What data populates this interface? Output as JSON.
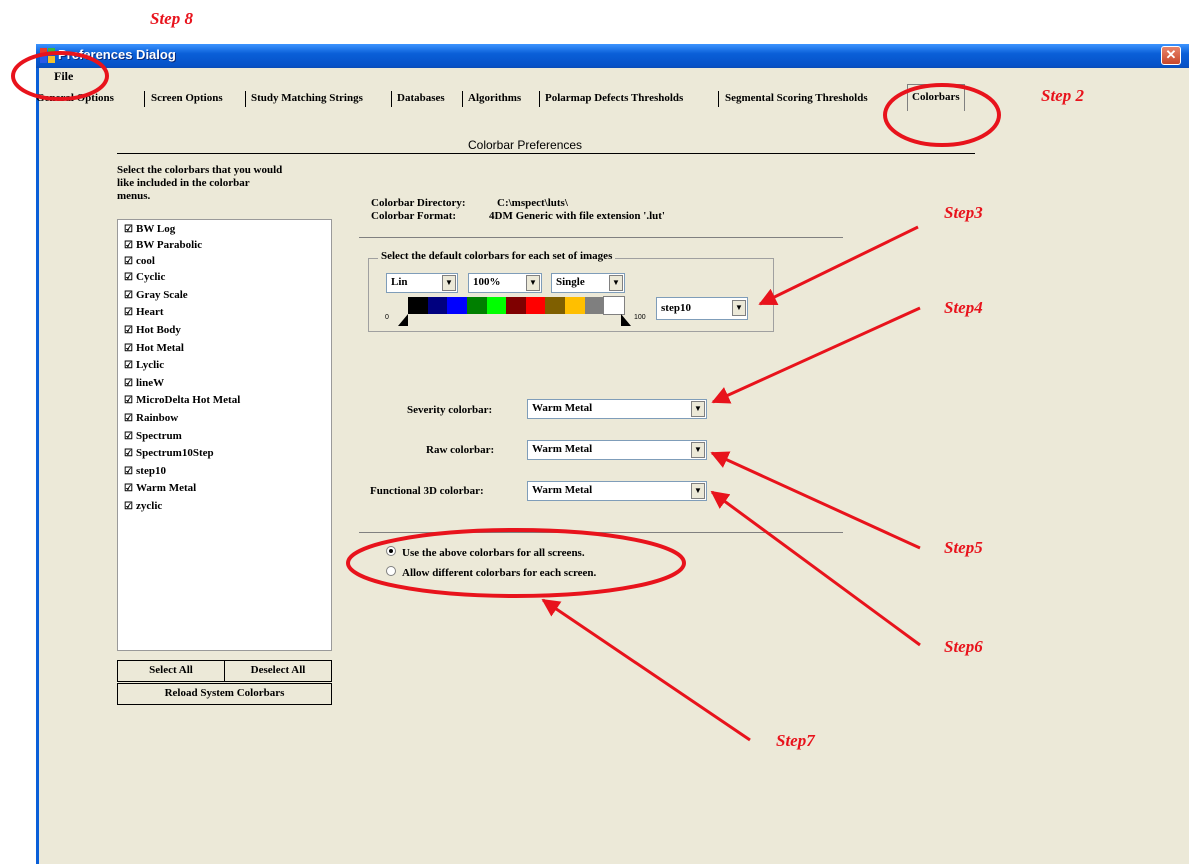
{
  "window": {
    "title": "Preferences Dialog",
    "close_glyph": "✕"
  },
  "menu": {
    "file": "File"
  },
  "tabs": [
    "General Options",
    "Screen Options",
    "Study Matching Strings",
    "Databases",
    "Algorithms",
    "Polarmap Defects Thresholds",
    "Segmental Scoring Thresholds",
    "Colorbars"
  ],
  "active_tab": "Colorbars",
  "section": {
    "heading": "Colorbar Preferences"
  },
  "left_panel": {
    "instructions": [
      "Select the colorbars that you would",
      "like included in the colorbar",
      "menus."
    ],
    "colorbars": [
      "BW Log",
      "BW Parabolic",
      "cool",
      "Cyclic",
      "Gray Scale",
      "Heart",
      "Hot Body",
      "Hot Metal",
      "Lyclic",
      "lineW",
      "MicroDelta Hot Metal",
      "Rainbow",
      "Spectrum",
      "Spectrum10Step",
      "step10",
      "Warm Metal",
      "zyclic"
    ],
    "select_all": "Select All",
    "deselect_all": "Deselect All",
    "reload": "Reload System Colorbars"
  },
  "info": {
    "dir_label": "Colorbar Directory:",
    "dir_value": "C:\\mspect\\luts\\",
    "format_label": "Colorbar Format:",
    "format_value": "4DM Generic with file extension '.lut'"
  },
  "default_group": {
    "legend": "Select the default colorbars for each set of images",
    "scale": "Lin",
    "percent": "100%",
    "mode": "Single",
    "min_label": "0",
    "max_label": "100",
    "colorbar": "step10",
    "swatch_colors": [
      "#000000",
      "#00007F",
      "#0000FF",
      "#007F00",
      "#00FF00",
      "#7F0000",
      "#FF0000",
      "#7F5F00",
      "#FFBF00",
      "#7F7F7F",
      "#FFFFFF"
    ]
  },
  "selectors": {
    "severity_label": "Severity colorbar:",
    "severity_value": "Warm Metal",
    "raw_label": "Raw colorbar:",
    "raw_value": "Warm Metal",
    "functional_label": "Functional 3D colorbar:",
    "functional_value": "Warm Metal"
  },
  "radios": {
    "all_screens": "Use the above colorbars for all screens.",
    "each_screen": "Allow different colorbars for each screen.",
    "selected": "all_screens"
  },
  "annotations": {
    "step8": "Step 8",
    "step2": "Step 2",
    "step3": "Step3",
    "step4": "Step4",
    "step5": "Step5",
    "step6": "Step6",
    "step7": "Step7",
    "color": "#E8131C"
  },
  "icons": {
    "arrow_down": "▼",
    "checkbox": "☑",
    "slider_marker": "◢"
  }
}
